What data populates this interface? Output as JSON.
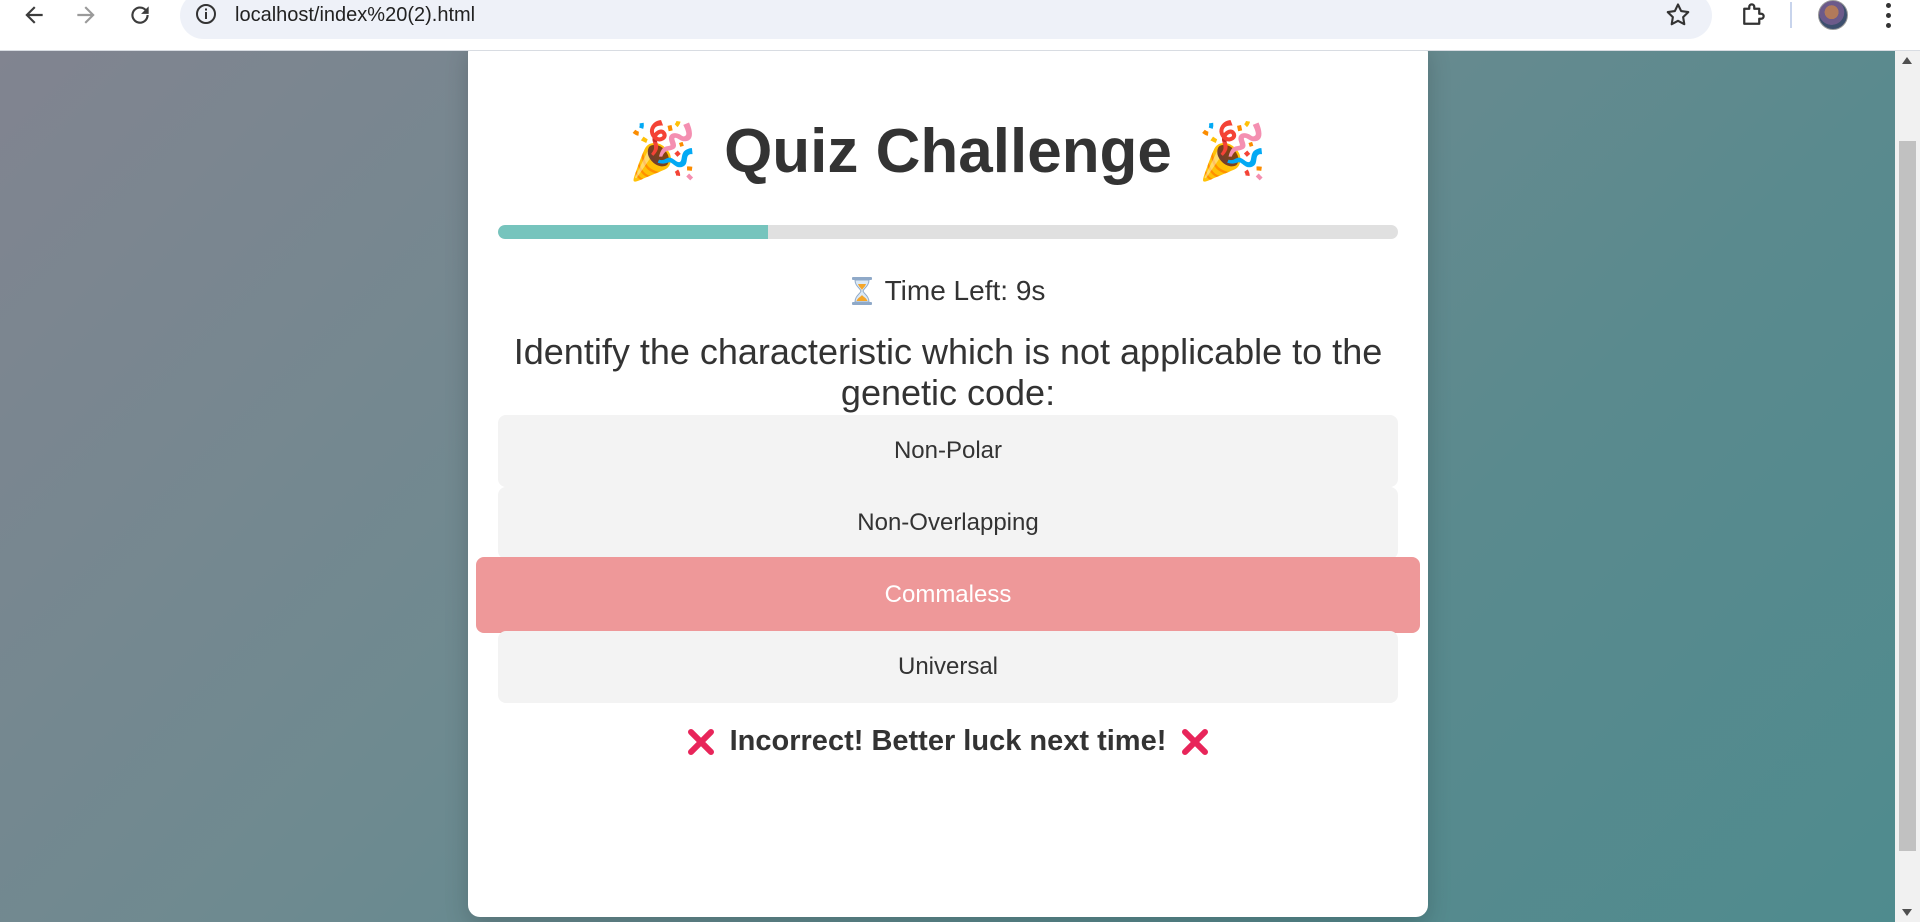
{
  "browser": {
    "url": "localhost/index%20(2).html",
    "icons": {
      "back": "back-arrow-icon",
      "forward": "forward-arrow-icon",
      "reload": "reload-icon",
      "info": "site-info-icon",
      "bookmark": "star-icon",
      "extensions": "puzzle-icon",
      "profile": "avatar",
      "menu": "more-vert-icon"
    }
  },
  "quiz": {
    "title": "Quiz Challenge",
    "title_emoji": "🎉",
    "progress_fraction": 0.3,
    "timer_icon": "hourglass-icon",
    "timer_text": "Time Left: 9s",
    "question": "Identify the characteristic which is not applicable to the genetic code:",
    "options": [
      {
        "label": "Non-Polar",
        "state": "default"
      },
      {
        "label": "Non-Overlapping",
        "state": "default"
      },
      {
        "label": "Commaless",
        "state": "incorrect"
      },
      {
        "label": "Universal",
        "state": "default"
      }
    ],
    "feedback": "Incorrect! Better luck next time!",
    "feedback_icon": "cross-mark-icon"
  },
  "colors": {
    "progress_fill": "#76c4bd",
    "progress_track": "#e0e0e0",
    "incorrect_option": "#ee9899",
    "option_bg": "#f3f3f3",
    "cross": "#e8255a",
    "text": "#333333"
  }
}
